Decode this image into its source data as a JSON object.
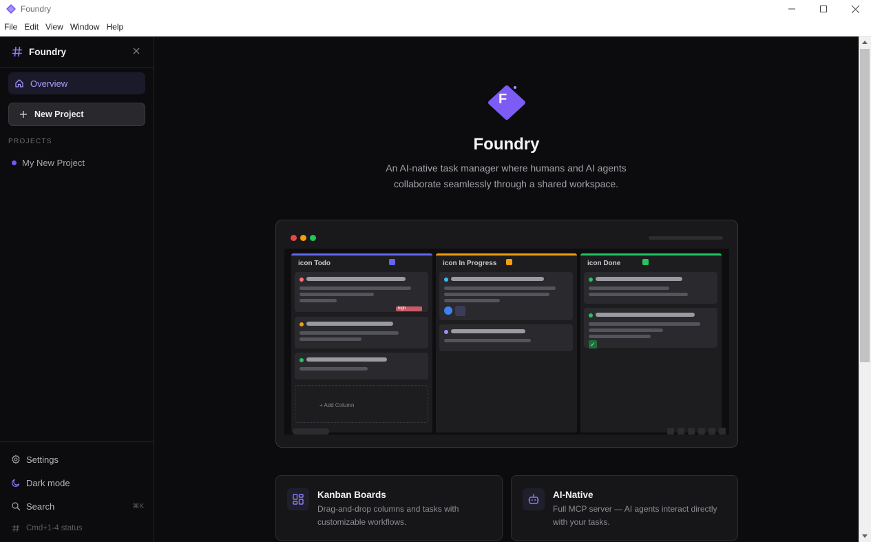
{
  "window": {
    "title": "Foundry",
    "colors": {
      "accent": "#7c5cf5",
      "background": "#0c0c0e"
    }
  },
  "menu": [
    "File",
    "Edit",
    "View",
    "Window",
    "Help"
  ],
  "sidebar": {
    "brand": "Foundry",
    "nav_overview": "Overview",
    "new_project": "New Project",
    "projects_heading": "PROJECTS",
    "projects": [
      {
        "name": "My New Project",
        "color": "#6b5cf5"
      }
    ],
    "footer": {
      "settings": "Settings",
      "dark_mode": "Dark mode",
      "search": "Search",
      "search_shortcut": "⌘K",
      "status": "Cmd+1-4 status"
    }
  },
  "hero": {
    "logo_letter": "F",
    "title": "Foundry",
    "description": "An AI-native task manager where humans and AI agents collaborate seamlessly through a shared workspace."
  },
  "preview": {
    "columns": [
      {
        "title": "icon Todo",
        "color": "#6366f1"
      },
      {
        "title": "icon In Progress",
        "color": "#f59e0b"
      },
      {
        "title": "icon Done",
        "color": "#22c55e"
      }
    ],
    "tag_label": "high",
    "add_column": "+ Add Column",
    "check_mark": "✓"
  },
  "features": [
    {
      "title": "Kanban Boards",
      "description": "Drag-and-drop columns and tasks with customizable workflows.",
      "icon": "kanban-icon"
    },
    {
      "title": "AI-Native",
      "description": "Full MCP server — AI agents interact directly with your tasks.",
      "icon": "robot-icon"
    }
  ]
}
